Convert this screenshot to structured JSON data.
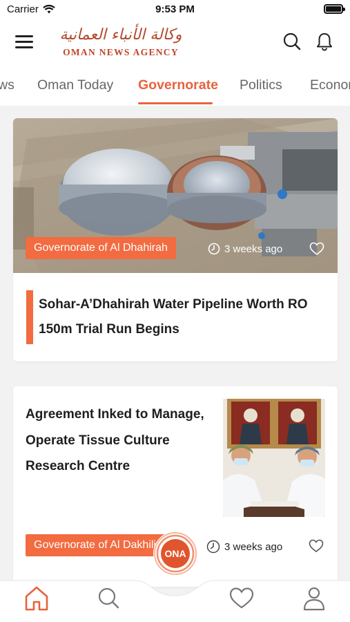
{
  "status_bar": {
    "carrier": "Carrier",
    "time": "9:53 PM"
  },
  "header": {
    "logo_arabic": "وكالة الأنباء العمانية",
    "logo_english": "OMAN NEWS AGENCY",
    "menu_icon": "hamburger-menu-icon",
    "search_icon": "search-icon",
    "notifications_icon": "bell-icon"
  },
  "tabs": [
    {
      "label": "ws"
    },
    {
      "label": "Oman Today"
    },
    {
      "label": "Governorate",
      "active": true
    },
    {
      "label": "Politics"
    },
    {
      "label": "Econom"
    }
  ],
  "articles": [
    {
      "tag": "Governorate of Al Dhahirah",
      "time": "3 weeks ago",
      "title": "Sohar-A’Dhahirah Water Pipeline Worth RO 150m Trial Run Begins"
    },
    {
      "tag": "Governorate of Al Dakhiliya",
      "time": "3 weeks ago",
      "title": "Agreement Inked to Manage, Operate Tissue Culture Research Centre"
    }
  ],
  "bottom_nav": {
    "center_button": "ONA",
    "items": [
      "home-icon",
      "search-icon",
      "heart-icon",
      "profile-icon"
    ]
  },
  "colors": {
    "accent": "#f36b40",
    "active_tab": "#e8623d",
    "background": "#f2f2f2"
  }
}
